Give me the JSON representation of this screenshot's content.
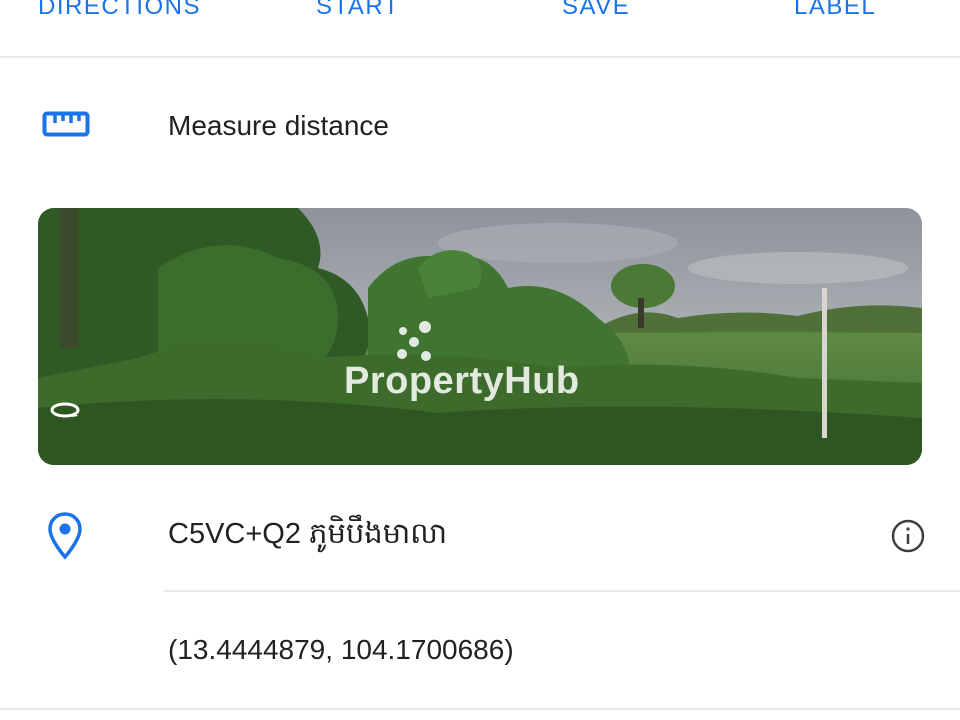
{
  "actions": {
    "directions": "DIRECTIONS",
    "start": "START",
    "save": "SAVE",
    "label": "LABEL"
  },
  "measure": {
    "icon": "ruler-icon",
    "label": "Measure distance"
  },
  "street_view": {
    "watermark": "PropertyHub",
    "icon": "rotate-360-icon"
  },
  "place": {
    "icon": "location-pin-icon",
    "plus_code": "C5VC+Q2 ភូមិបឹងមាលា",
    "info_icon": "info-icon",
    "coordinates": "(13.4444879, 104.1700686)"
  },
  "colors": {
    "accent": "#1a73e8",
    "text": "#202124",
    "divider": "#e6e8eb"
  }
}
